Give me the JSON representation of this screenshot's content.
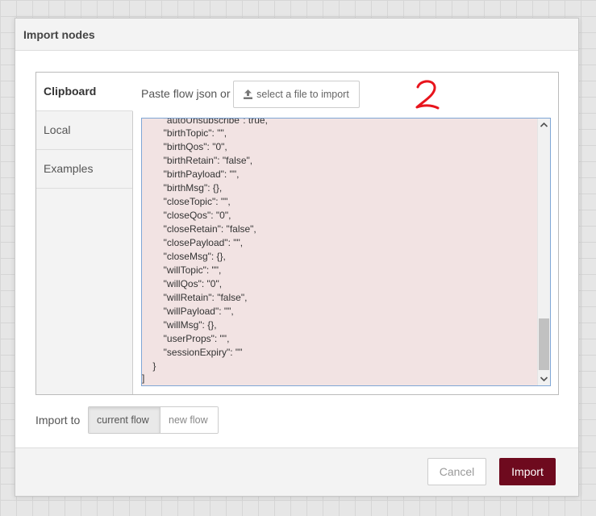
{
  "dialog": {
    "title": "Import nodes"
  },
  "tabs": [
    {
      "label": "Clipboard",
      "active": true
    },
    {
      "label": "Local",
      "active": false
    },
    {
      "label": "Examples",
      "active": false
    }
  ],
  "clipboard": {
    "paste_label": "Paste flow json or",
    "file_button_label": "select a file to import",
    "file_button_icon": "upload-icon"
  },
  "annotation": {
    "text": "2",
    "color": "#e8141c"
  },
  "editor": {
    "background": "#f2e3e3",
    "lines": [
      "        \"autoUnsubscribe\": true,",
      "        \"birthTopic\": \"\",",
      "        \"birthQos\": \"0\",",
      "        \"birthRetain\": \"false\",",
      "        \"birthPayload\": \"\",",
      "        \"birthMsg\": {},",
      "        \"closeTopic\": \"\",",
      "        \"closeQos\": \"0\",",
      "        \"closeRetain\": \"false\",",
      "        \"closePayload\": \"\",",
      "        \"closeMsg\": {},",
      "        \"willTopic\": \"\",",
      "        \"willQos\": \"0\",",
      "        \"willRetain\": \"false\",",
      "        \"willPayload\": \"\",",
      "        \"willMsg\": {},",
      "        \"userProps\": \"\",",
      "        \"sessionExpiry\": \"\"",
      "    }",
      "]"
    ]
  },
  "import_to": {
    "label": "Import to",
    "options": [
      {
        "label": "current flow",
        "selected": true
      },
      {
        "label": "new flow",
        "selected": false
      }
    ]
  },
  "footer": {
    "cancel_label": "Cancel",
    "import_label": "Import",
    "import_color": "#6e0a1e"
  }
}
